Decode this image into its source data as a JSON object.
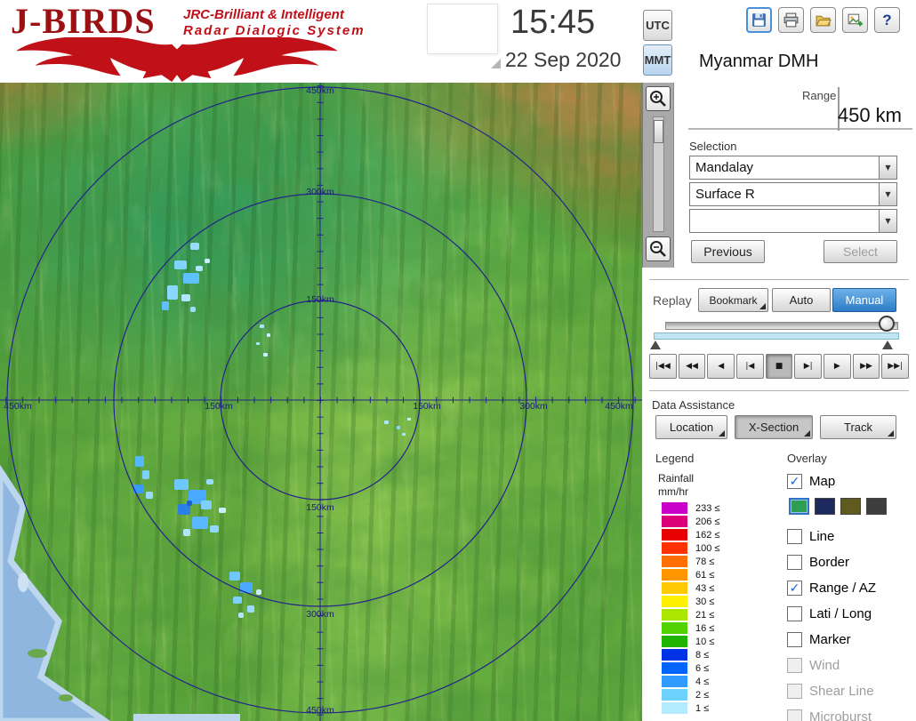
{
  "header": {
    "logo": {
      "title": "J-BIRDS",
      "tagline_line1": "JRC-Brilliant & Intelligent",
      "tagline_line2": "Radar Dialogic System"
    },
    "clock": {
      "time": "15:45",
      "date": "22 Sep 2020"
    },
    "timezone": {
      "utc_label": "UTC",
      "mmt_label": "MMT",
      "selected": "MMT"
    },
    "toolbar": {
      "icons": [
        "save-icon",
        "print-icon",
        "open-folder-icon",
        "add-image-icon",
        "help-icon"
      ],
      "help_glyph": "?"
    },
    "station_name": "Myanmar DMH"
  },
  "range": {
    "label": "Range",
    "value": "450 km"
  },
  "selection": {
    "label": "Selection",
    "site": "Mandalay",
    "product": "Surface R",
    "extra": "",
    "previous_label": "Previous",
    "select_label": "Select"
  },
  "replay": {
    "label": "Replay",
    "bookmark_label": "Bookmark",
    "auto_label": "Auto",
    "manual_label": "Manual",
    "active_mode": "Manual",
    "playback_controls": [
      "|◀◀",
      "◀◀",
      "◀",
      "|◀",
      "■",
      "▶|",
      "▶",
      "▶▶",
      "▶▶|"
    ]
  },
  "data_assistance": {
    "label": "Data Assistance",
    "location_label": "Location",
    "xsection_label": "X-Section",
    "track_label": "Track",
    "active": "X-Section"
  },
  "legend": {
    "label": "Legend",
    "quantity": "Rainfall",
    "unit": "mm/hr",
    "scale": [
      {
        "value": "233 ≤",
        "color": "#c800c8"
      },
      {
        "value": "206 ≤",
        "color": "#dc0078"
      },
      {
        "value": "162 ≤",
        "color": "#e60000"
      },
      {
        "value": "100 ≤",
        "color": "#ff3200"
      },
      {
        "value": "78 ≤",
        "color": "#ff6e00"
      },
      {
        "value": "61 ≤",
        "color": "#ff9600"
      },
      {
        "value": "43 ≤",
        "color": "#ffc800"
      },
      {
        "value": "30 ≤",
        "color": "#fff000"
      },
      {
        "value": "21 ≤",
        "color": "#aae600"
      },
      {
        "value": "16 ≤",
        "color": "#50d200"
      },
      {
        "value": "10 ≤",
        "color": "#1eb400"
      },
      {
        "value": "8 ≤",
        "color": "#0032e6"
      },
      {
        "value": "6 ≤",
        "color": "#0064ff"
      },
      {
        "value": "4 ≤",
        "color": "#329bff"
      },
      {
        "value": "2 ≤",
        "color": "#6ed2ff"
      },
      {
        "value": "1 ≤",
        "color": "#b4ebff"
      }
    ]
  },
  "overlay": {
    "label": "Overlay",
    "items": [
      {
        "label": "Map",
        "checked": true,
        "disabled": false
      },
      {
        "label": "Line",
        "checked": false,
        "disabled": false
      },
      {
        "label": "Border",
        "checked": false,
        "disabled": false
      },
      {
        "label": "Range / AZ",
        "checked": true,
        "disabled": false
      },
      {
        "label": "Lati / Long",
        "checked": false,
        "disabled": false
      },
      {
        "label": "Marker",
        "checked": false,
        "disabled": false
      },
      {
        "label": "Wind",
        "checked": false,
        "disabled": true
      },
      {
        "label": "Shear Line",
        "checked": false,
        "disabled": true
      },
      {
        "label": "Microburst",
        "checked": false,
        "disabled": true
      }
    ],
    "map_color_options": [
      "#2f9e52",
      "#1c2a60",
      "#5e5a20",
      "#3e3e3e"
    ],
    "selected_map_color_index": 0
  },
  "map": {
    "axis_labels_vertical": [
      "450km",
      "300km",
      "150km",
      "150km",
      "300km",
      "450km"
    ],
    "axis_labels_horizontal": [
      "450km",
      "150km",
      "150km",
      "300km",
      "450km"
    ]
  }
}
